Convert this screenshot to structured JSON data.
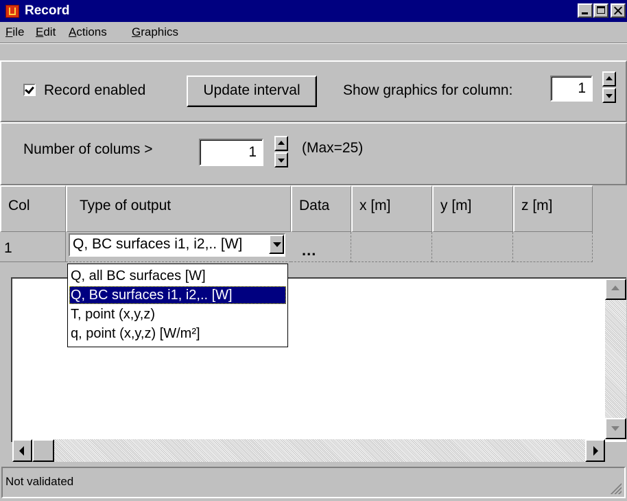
{
  "window": {
    "title": "Record"
  },
  "menu": {
    "items": [
      {
        "accel": "F",
        "rest": "ile"
      },
      {
        "accel": "E",
        "rest": "dit"
      },
      {
        "accel": "A",
        "rest": "ctions"
      },
      {
        "accel": "G",
        "rest": "raphics"
      }
    ]
  },
  "toolbar": {
    "record_enabled_label": "Record enabled",
    "record_enabled_checked": true,
    "update_interval_label": "Update interval",
    "show_graphics_label": "Show graphics for column:",
    "show_graphics_value": "1"
  },
  "columns_row": {
    "label": "Number of colums  >",
    "value": "1",
    "max_label": "(Max=25)"
  },
  "table": {
    "headers": [
      "Col",
      "Type of output",
      "Data",
      "x [m]",
      "y [m]",
      "z [m]"
    ],
    "rows": [
      {
        "col": "1",
        "type": "Q, BC surfaces i1, i2,.. [W]",
        "data": "...",
        "x": "",
        "y": "",
        "z": ""
      }
    ]
  },
  "dropdown": {
    "options": [
      "Q, all BC surfaces [W]",
      "Q, BC surfaces i1, i2,.. [W]",
      "T, point (x,y,z)",
      "q, point (x,y,z)  [W/m²]"
    ],
    "selected_index": 1
  },
  "status": {
    "text": "Not validated"
  }
}
